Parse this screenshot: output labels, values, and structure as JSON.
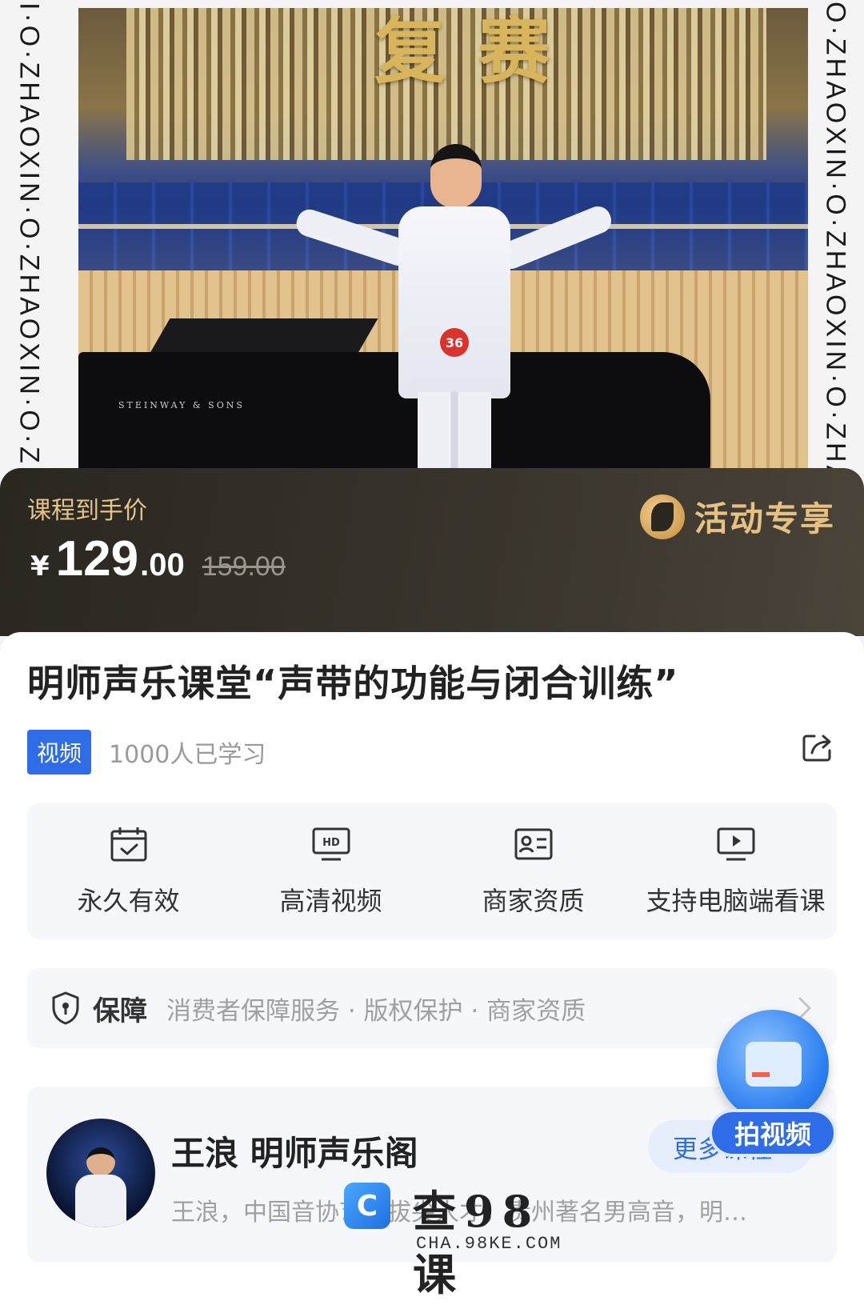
{
  "hero": {
    "side_text_left": "I·O·ZHAOXIN·O·ZHAOXIN·O·ZHA",
    "side_text_right": "O·ZHAOXIN·O·ZHAOXIN·O·ZHAO",
    "banner_text": "复赛",
    "piano_brand": "STEINWAY & SONS",
    "contestant_number": "36"
  },
  "price": {
    "label": "课程到手价",
    "currency": "¥",
    "integer": "129",
    "decimal": ".00",
    "original": "159.00",
    "promo": "活动专享"
  },
  "course": {
    "title": "明师声乐课堂“声带的功能与闭合训练”",
    "type_badge": "视频",
    "learners": "1000人已学习"
  },
  "features": [
    {
      "label": "永久有效",
      "icon": "calendar-check-icon"
    },
    {
      "label": "高清视频",
      "icon": "hd-icon"
    },
    {
      "label": "商家资质",
      "icon": "id-card-icon"
    },
    {
      "label": "支持电脑端看课",
      "icon": "monitor-play-icon"
    }
  ],
  "guarantee": {
    "title": "保障",
    "items": "消费者保障服务 · 版权保护 · 商家资质"
  },
  "teacher": {
    "name": "王浪  明师声乐阁",
    "description": "王浪，中国音协艺术拔尖人才，贵州著名男高音，明…",
    "more_button": "更多课程"
  },
  "fab": {
    "label": "拍视频"
  },
  "watermark": {
    "logo": "C",
    "title": "查98课",
    "subtitle": "CHA.98KE.COM"
  },
  "colors": {
    "accent": "#2f6de8",
    "price_bar": "#2a2620",
    "promo_gold": "#e7c182"
  }
}
